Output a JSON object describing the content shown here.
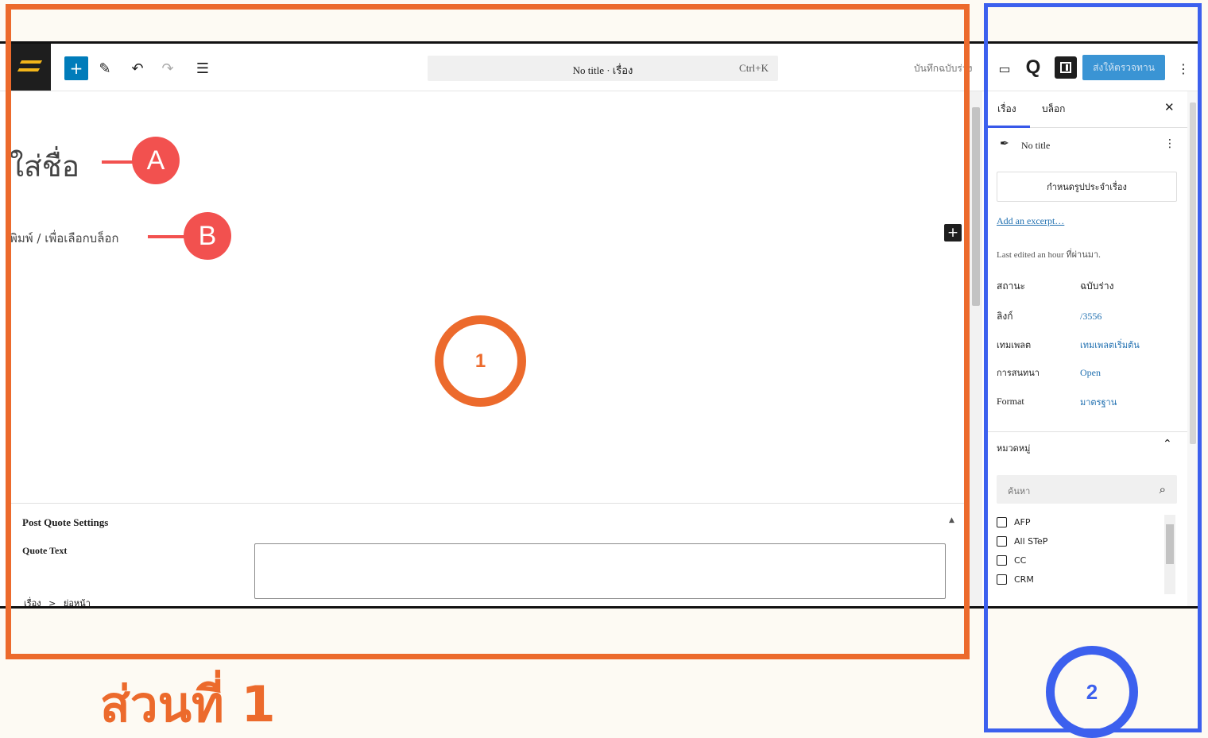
{
  "toolbar": {
    "command_title": "No title · เรื่อง",
    "command_shortcut": "Ctrl+K",
    "saved_label": "บันทึกฉบับร่าง",
    "publish_label": "ส่งให้ตรวจทาน"
  },
  "editor": {
    "title_placeholder": "ใส่ชื่อ",
    "block_placeholder": "พิมพ์ / เพื่อเลือกบล็อก"
  },
  "metabox": {
    "title": "Post Quote Settings",
    "field_label": "Quote Text",
    "field_value": ""
  },
  "breadcrumb": {
    "root": "เรื่อง",
    "separator": ">",
    "current": "ย่อหน้า"
  },
  "sidebar": {
    "tabs": [
      {
        "label": "เรื่อง",
        "active": true
      },
      {
        "label": "บล็อก",
        "active": false
      }
    ],
    "post_title": "No title",
    "format_button": "กำหนดรูปประจำเรื่อง",
    "excerpt_link": "Add an excerpt…",
    "last_edited": "Last edited an hour ที่ผ่านมา.",
    "rows": [
      {
        "label": "สถานะ",
        "value": "ฉบับร่าง"
      },
      {
        "label": "ลิงก์",
        "value": "/3556"
      },
      {
        "label": "เทมเพลต",
        "value": "เทมเพลตเริ่มต้น"
      },
      {
        "label": "การสนทนา",
        "value": "Open"
      },
      {
        "label": "Format",
        "value": "มาตรฐาน"
      }
    ],
    "categories_title": "หมวดหมู่",
    "search_placeholder": "ค้นหา",
    "categories": [
      "AFP",
      "All STeP",
      "CC",
      "CRM"
    ]
  },
  "annotations": {
    "marker_a": "A",
    "marker_b": "B",
    "section_1": "1",
    "section_2": "2",
    "part_title": "ส่วนที่ 1"
  },
  "colors": {
    "accent_orange": "#ec6a2c",
    "accent_blue": "#3c60ee",
    "marker_red": "#f2514f",
    "wp_blue": "#007cba"
  }
}
